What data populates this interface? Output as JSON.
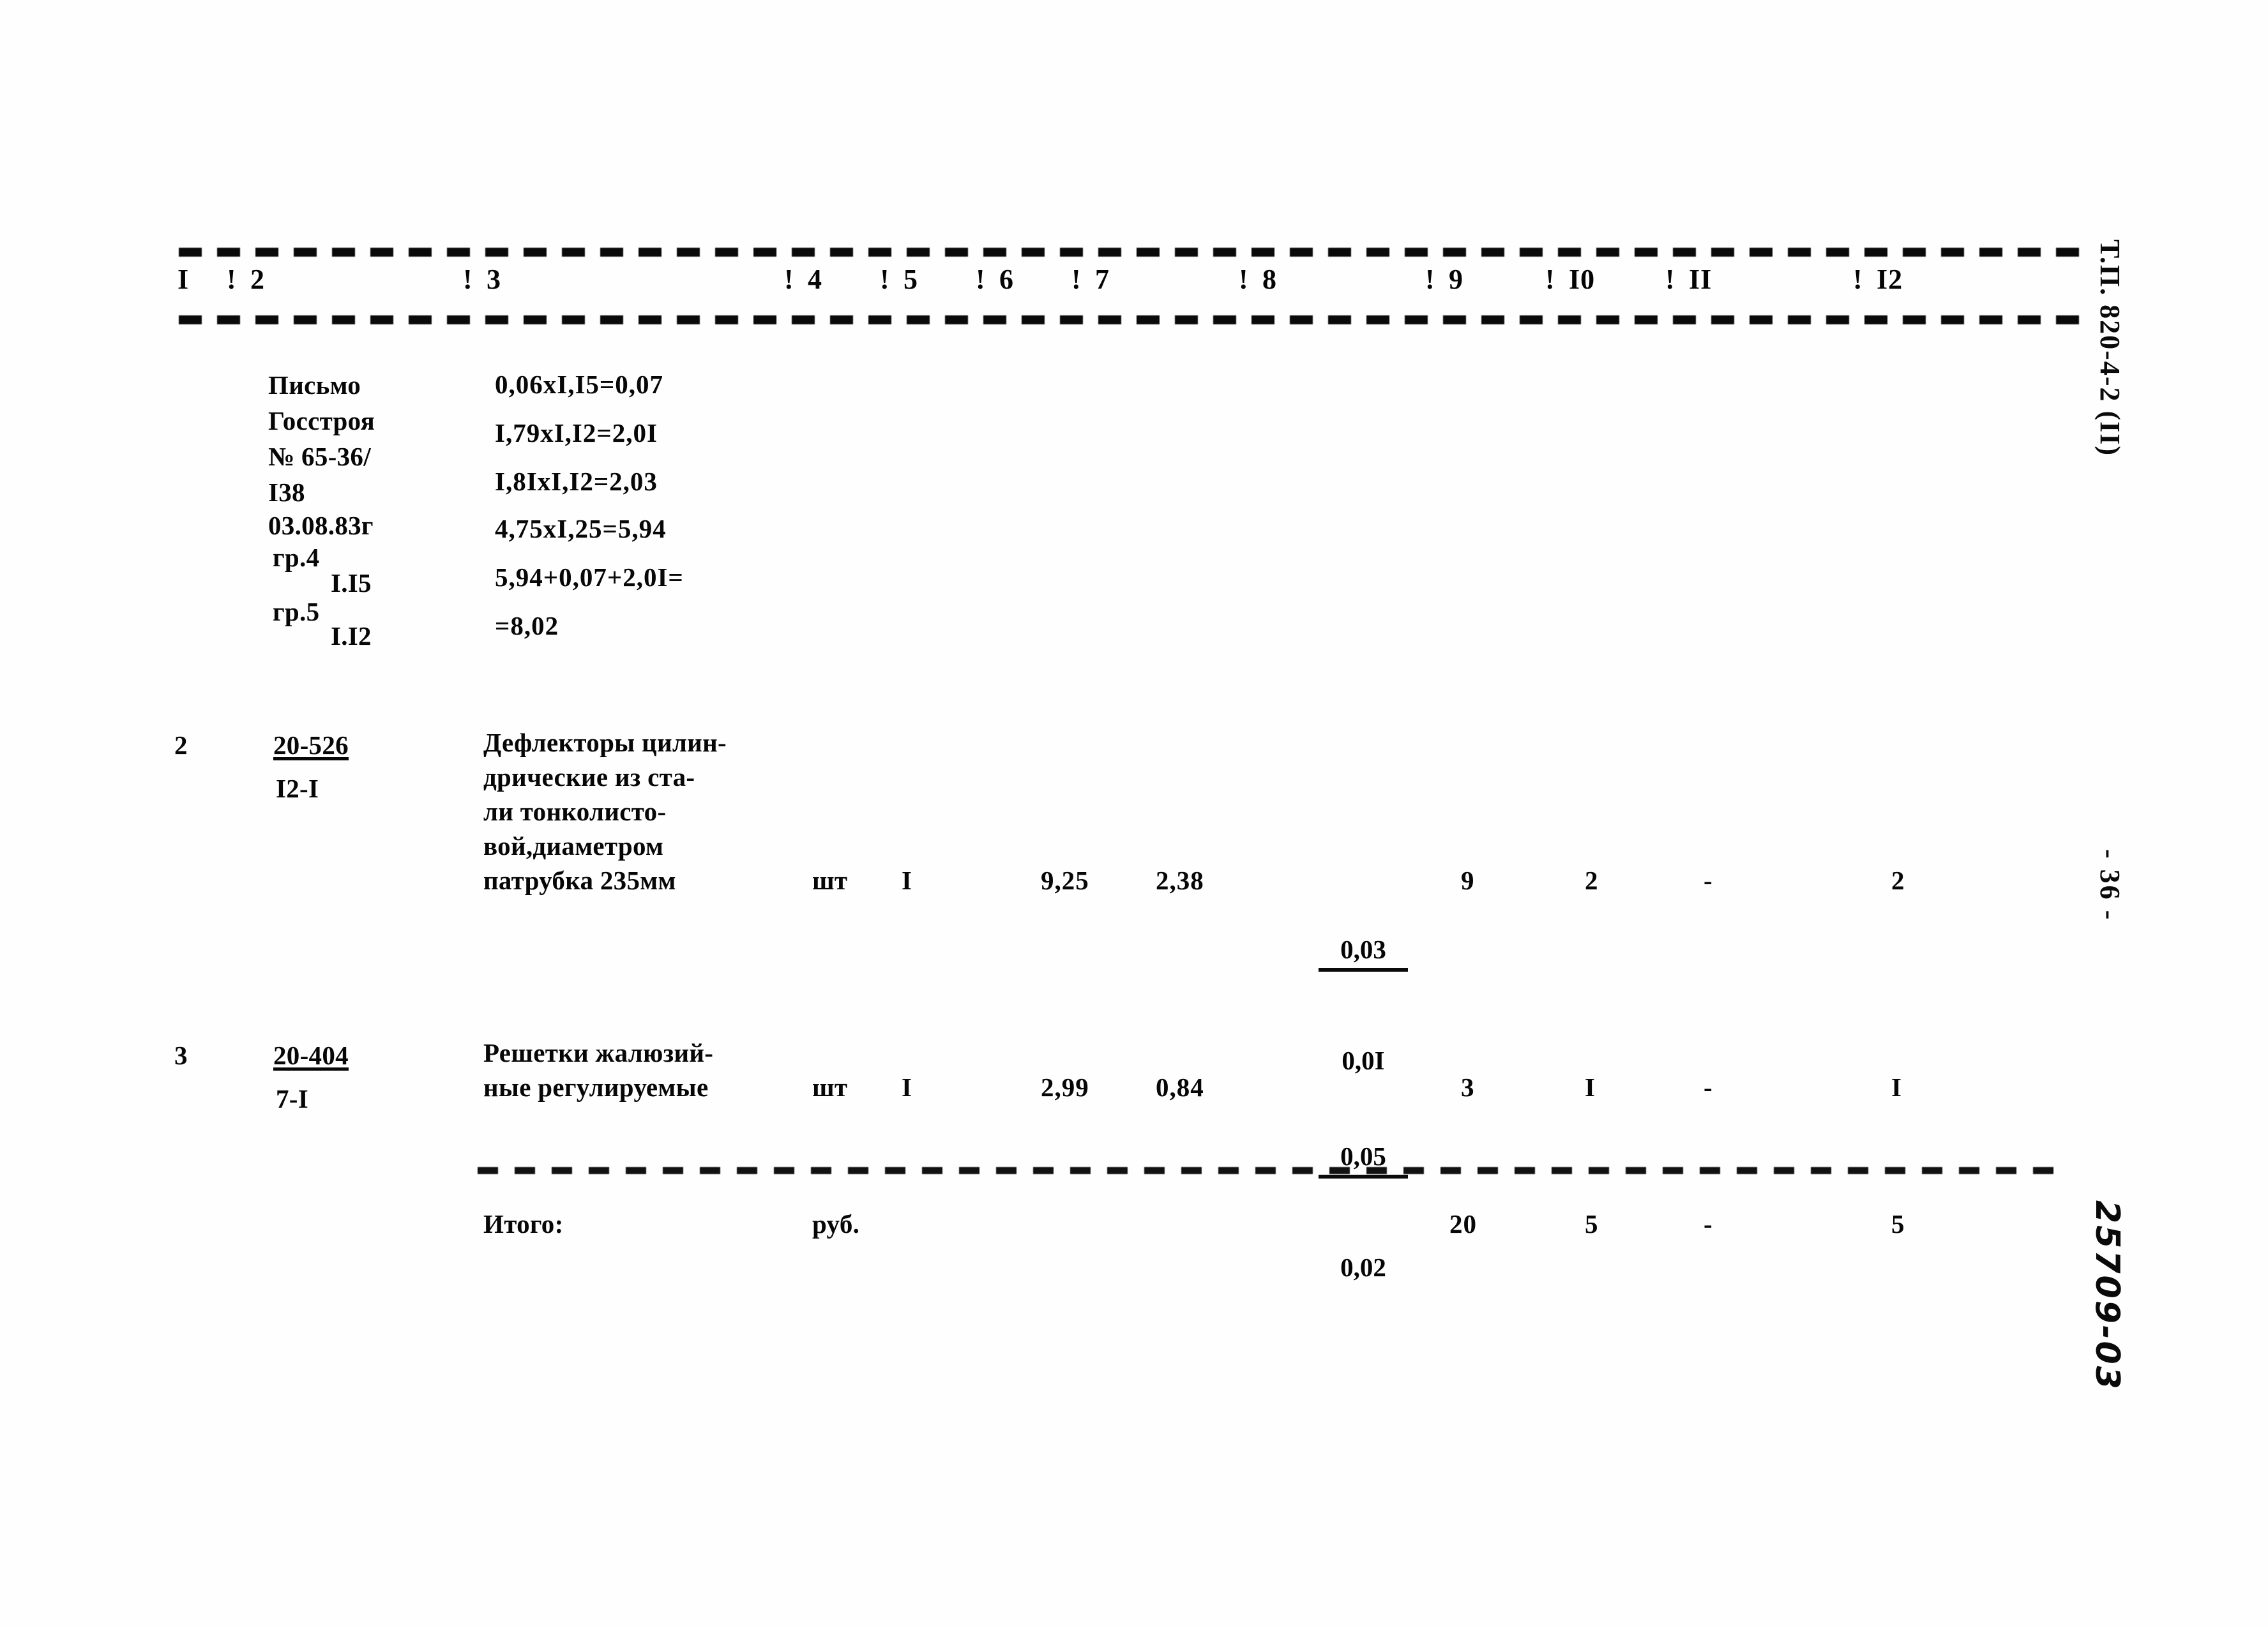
{
  "document": {
    "series_mark": "Т.П. 820-4-2 (II)",
    "page_number": "- 36 -",
    "archive_number": "25709-03"
  },
  "table": {
    "column_headers": [
      "I",
      "2",
      "3",
      "4",
      "5",
      "6",
      "7",
      "8",
      "9",
      "I0",
      "II",
      "I2"
    ],
    "column_separator": "!",
    "rows": [
      {
        "no": "",
        "code": "",
        "code_sub": "",
        "justification_lines": [
          "Письмо",
          "Госстроя",
          "№ 65-36/",
          "I38",
          "03.08.83г",
          "гр.4",
          "I.I5",
          "гр.5",
          "I.I2"
        ],
        "calculation_lines": [
          "0,06xI,I5=0,07",
          "I,79xI,I2=2,0I",
          "I,8IxI,I2=2,03",
          "4,75xI,25=5,94",
          "5,94+0,07+2,0I=",
          "=8,02"
        ],
        "unit": "",
        "qty": "",
        "col6": "",
        "col7": "",
        "col8_top": "",
        "col8_bottom": "",
        "col9": "",
        "col10": "",
        "col11": "",
        "col12": ""
      },
      {
        "no": "2",
        "code": "20-526",
        "code_sub": "I2-I",
        "description_lines": [
          "Дефлекторы цилин-",
          "дрические из ста-",
          "ли тонколисто-",
          "вой,диаметром",
          "патрубка 235мм"
        ],
        "unit": "шт",
        "qty": "I",
        "col6": "9,25",
        "col7": "2,38",
        "col8_top": "0,03",
        "col8_bottom": "0,0I",
        "col9": "9",
        "col10": "2",
        "col11": "-",
        "col12": "2"
      },
      {
        "no": "3",
        "code": "20-404",
        "code_sub": "7-I",
        "description_lines": [
          "Решетки жалюзий-",
          "ные регулируемые"
        ],
        "unit": "шт",
        "qty": "I",
        "col6": "2,99",
        "col7": "0,84",
        "col8_top": "0,05",
        "col8_bottom": "0,02",
        "col9": "3",
        "col10": "I",
        "col11": "-",
        "col12": "I"
      }
    ],
    "total_row": {
      "label": "Итого:",
      "unit": "руб.",
      "col9": "20",
      "col10": "5",
      "col11": "-",
      "col12": "5"
    }
  }
}
